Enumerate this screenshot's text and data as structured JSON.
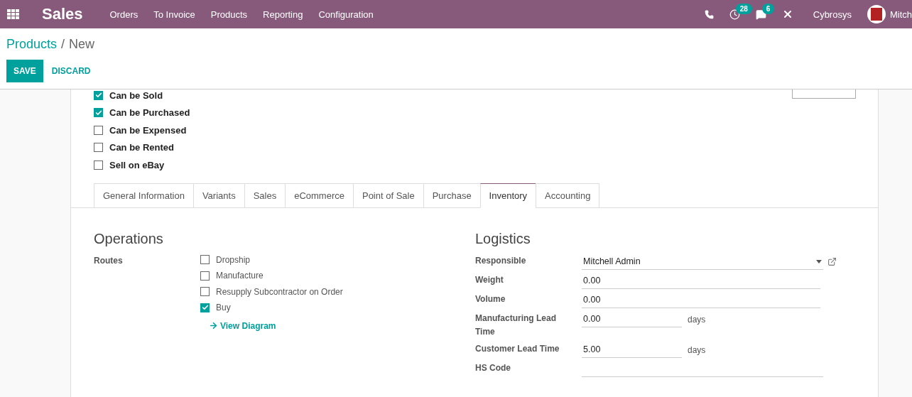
{
  "navbar": {
    "app_name": "Sales",
    "menu": [
      "Orders",
      "To Invoice",
      "Products",
      "Reporting",
      "Configuration"
    ],
    "activity_count": "28",
    "message_count": "6",
    "company": "Cybrosys",
    "user": "Mitch"
  },
  "breadcrumb": {
    "parent": "Products",
    "separator": "/",
    "current": "New"
  },
  "buttons": {
    "save": "SAVE",
    "discard": "DISCARD"
  },
  "options": [
    {
      "label": "Can be Sold",
      "checked": true
    },
    {
      "label": "Can be Purchased",
      "checked": true
    },
    {
      "label": "Can be Expensed",
      "checked": false
    },
    {
      "label": "Can be Rented",
      "checked": false
    },
    {
      "label": "Sell on eBay",
      "checked": false
    }
  ],
  "tabs": [
    {
      "label": "General Information",
      "selected": false
    },
    {
      "label": "Variants",
      "selected": false
    },
    {
      "label": "Sales",
      "selected": false
    },
    {
      "label": "eCommerce",
      "selected": false
    },
    {
      "label": "Point of Sale",
      "selected": false
    },
    {
      "label": "Purchase",
      "selected": false
    },
    {
      "label": "Inventory",
      "selected": true
    },
    {
      "label": "Accounting",
      "selected": false
    }
  ],
  "operations": {
    "title": "Operations",
    "routes_label": "Routes",
    "routes": [
      {
        "label": "Dropship",
        "checked": false
      },
      {
        "label": "Manufacture",
        "checked": false
      },
      {
        "label": "Resupply Subcontractor on Order",
        "checked": false
      },
      {
        "label": "Buy",
        "checked": true
      }
    ],
    "diagram_link": "View Diagram"
  },
  "logistics": {
    "title": "Logistics",
    "fields": [
      {
        "kind": "select",
        "label": "Responsible",
        "value": "Mitchell Admin"
      },
      {
        "kind": "text",
        "label": "Weight",
        "value": "0.00"
      },
      {
        "kind": "text",
        "label": "Volume",
        "value": "0.00"
      },
      {
        "kind": "unit",
        "label": "Manufacturing Lead Time",
        "value": "0.00",
        "unit": "days"
      },
      {
        "kind": "unit",
        "label": "Customer Lead Time",
        "value": "5.00",
        "unit": "days"
      },
      {
        "kind": "text",
        "label": "HS Code"
      }
    ]
  }
}
